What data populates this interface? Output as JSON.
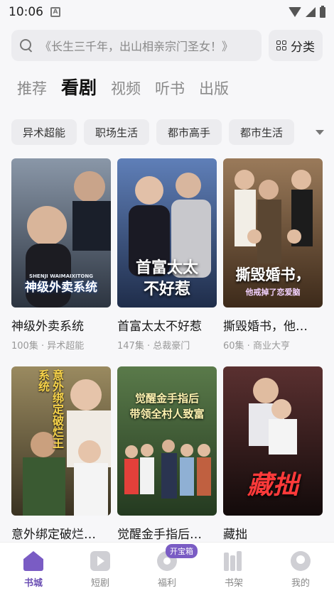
{
  "status_bar": {
    "time": "10:06",
    "icon_a": "A"
  },
  "search": {
    "placeholder": "《长生三千年，出山相亲宗门圣女！》",
    "category_label": "分类"
  },
  "tabs": [
    {
      "label": "推荐",
      "active": false
    },
    {
      "label": "看剧",
      "active": true
    },
    {
      "label": "视频",
      "active": false
    },
    {
      "label": "听书",
      "active": false
    },
    {
      "label": "出版",
      "active": false
    }
  ],
  "chips": [
    "异术超能",
    "职场生活",
    "都市高手",
    "都市生活"
  ],
  "cards": [
    {
      "title": "神级外卖系统",
      "meta": "100集 · 异术超能",
      "cover_caption": "神级外卖系统",
      "cover_sub": "SHENJI WAIMAIXITONG",
      "colors": [
        "#8a97a8",
        "#2c3440"
      ]
    },
    {
      "title": "首富太太不好惹",
      "meta": "147集 · 总裁豪门",
      "cover_caption": "首富太太\n不好惹",
      "cover_sub": "",
      "colors": [
        "#5f7fb8",
        "#1f2d4a"
      ]
    },
    {
      "title": "撕毁婚书，他…",
      "meta": "60集 · 商业大亨",
      "cover_caption": "撕毁婚书，",
      "cover_sub": "他戒掉了恋爱脑",
      "colors": [
        "#9a7a5a",
        "#3d2a1a"
      ]
    },
    {
      "title": "意外绑定破烂…",
      "meta": "",
      "cover_caption": "意外绑定破烂王系统",
      "cover_sub": "",
      "colors": [
        "#9a8a60",
        "#3a3322"
      ]
    },
    {
      "title": "觉醒金手指后…",
      "meta": "",
      "cover_caption": "觉醒金手指后\n带领全村人致富",
      "cover_sub": "",
      "colors": [
        "#5a7a4a",
        "#243a20"
      ]
    },
    {
      "title": "藏拙",
      "meta": "",
      "cover_caption": "藏拙",
      "cover_sub": "",
      "colors": [
        "#5a3030",
        "#120a0a"
      ]
    }
  ],
  "bottom_nav": {
    "items": [
      {
        "label": "书城",
        "active": true
      },
      {
        "label": "短剧",
        "active": false
      },
      {
        "label": "福利",
        "active": false
      },
      {
        "label": "书架",
        "active": false
      },
      {
        "label": "我的",
        "active": false
      }
    ],
    "badge": "开宝箱"
  },
  "colors": {
    "accent": "#7a5cc4"
  }
}
